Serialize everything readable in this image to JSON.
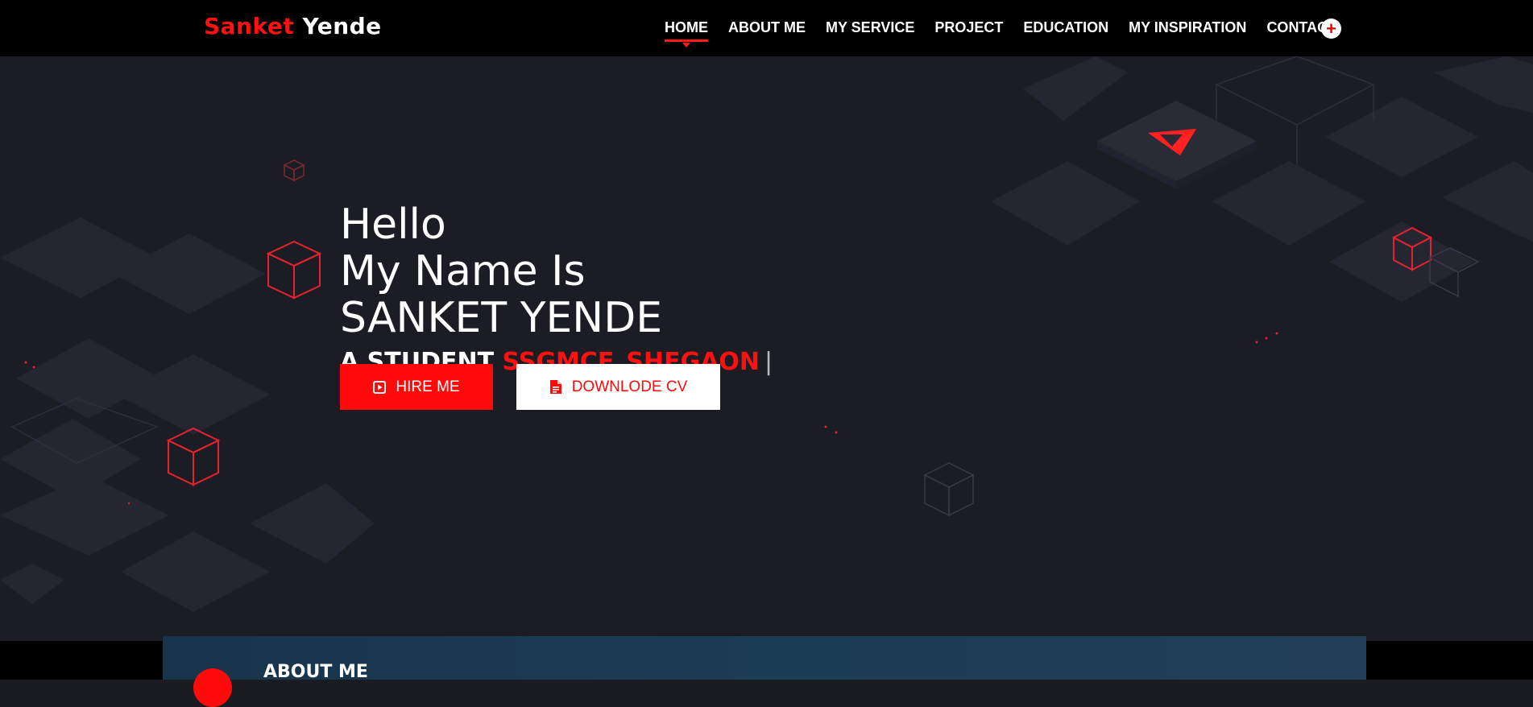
{
  "brand": {
    "first": "Sanket",
    "last": "Yende"
  },
  "nav": {
    "items": [
      {
        "label": "HOME",
        "active": true
      },
      {
        "label": "ABOUT ME"
      },
      {
        "label": "MY SERVICE"
      },
      {
        "label": "PROJECT"
      },
      {
        "label": "EDUCATION"
      },
      {
        "label": "MY INSPIRATION"
      },
      {
        "label": "CONTACT"
      }
    ],
    "extra_icon": "plus-icon"
  },
  "hero": {
    "line1": "Hello",
    "line2": "My Name Is",
    "line3": "SANKET YENDE",
    "sub_prefix": "A STUDENT",
    "sub_accent": "SSGMCE_SHEGAON",
    "caret": "|"
  },
  "buttons": {
    "hire": {
      "label": "HIRE ME",
      "icon": "play-square-icon"
    },
    "cv": {
      "label": "DOWNLODE CV",
      "icon": "document-icon"
    }
  },
  "about": {
    "title": "ABOUT ME"
  },
  "colors": {
    "accent": "#ff0a0a",
    "nav_bg": "#000000",
    "hero_bg": "#1c1c24"
  }
}
